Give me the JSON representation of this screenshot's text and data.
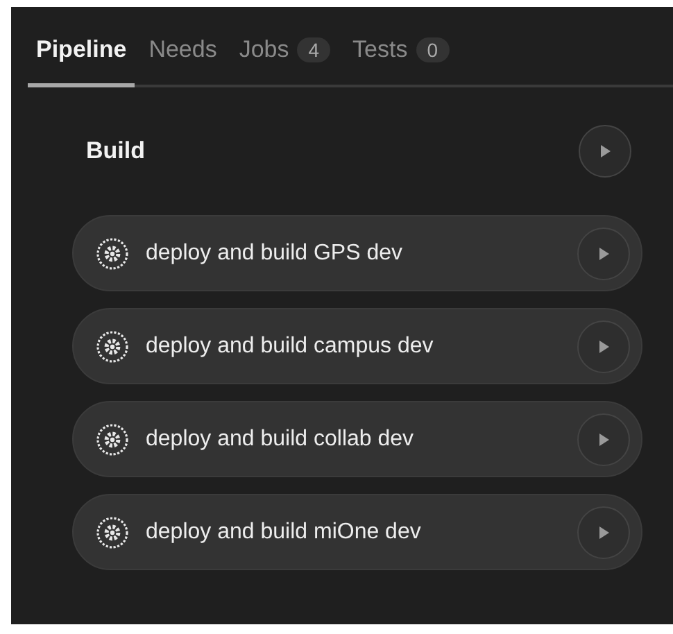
{
  "tabs": [
    {
      "label": "Pipeline",
      "selected": true
    },
    {
      "label": "Needs",
      "selected": false
    },
    {
      "label": "Jobs",
      "count": "4",
      "selected": false
    },
    {
      "label": "Tests",
      "count": "0",
      "selected": false
    }
  ],
  "stage": {
    "title": "Build",
    "jobs": [
      {
        "name": "deploy and build GPS dev",
        "kind": "manual"
      },
      {
        "name": "deploy and build campus dev",
        "kind": "manual"
      },
      {
        "name": "deploy and build collab dev",
        "kind": "manual"
      },
      {
        "name": "deploy and build miOne dev",
        "kind": "manual"
      }
    ]
  }
}
